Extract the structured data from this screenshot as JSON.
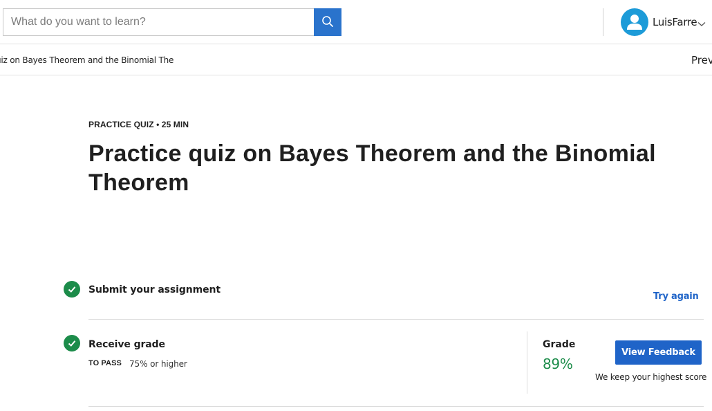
{
  "header": {
    "search": {
      "placeholder": "What do you want to learn?",
      "value": "",
      "button_icon": "search-icon"
    },
    "user": {
      "name": "LuisFarre",
      "avatar_icon": "user-avatar-icon",
      "menu_icon": "chevron-down-icon"
    }
  },
  "subnav": {
    "breadcrumb": "uiz on Bayes Theorem and the Binomial The",
    "prev_label": "Prev"
  },
  "main": {
    "kicker": "PRACTICE QUIZ • 25 MIN",
    "title": "Practice quiz on Bayes Theorem and the Binomial Theorem",
    "steps": [
      {
        "title": "Submit your assignment",
        "status_icon": "check-circle-icon",
        "action_label": "Try again"
      },
      {
        "title": "Receive grade",
        "status_icon": "check-circle-icon",
        "to_pass_label": "TO PASS",
        "to_pass_value": "75% or higher",
        "grade_label": "Grade",
        "grade_value": "89%",
        "feedback_button_label": "View Feedback",
        "note": "We keep your highest score"
      }
    ]
  },
  "colors": {
    "primary_blue": "#1f64c8",
    "search_blue": "#2a73cc",
    "success_green": "#1c8c4a",
    "avatar_blue": "#1d9bd8"
  }
}
